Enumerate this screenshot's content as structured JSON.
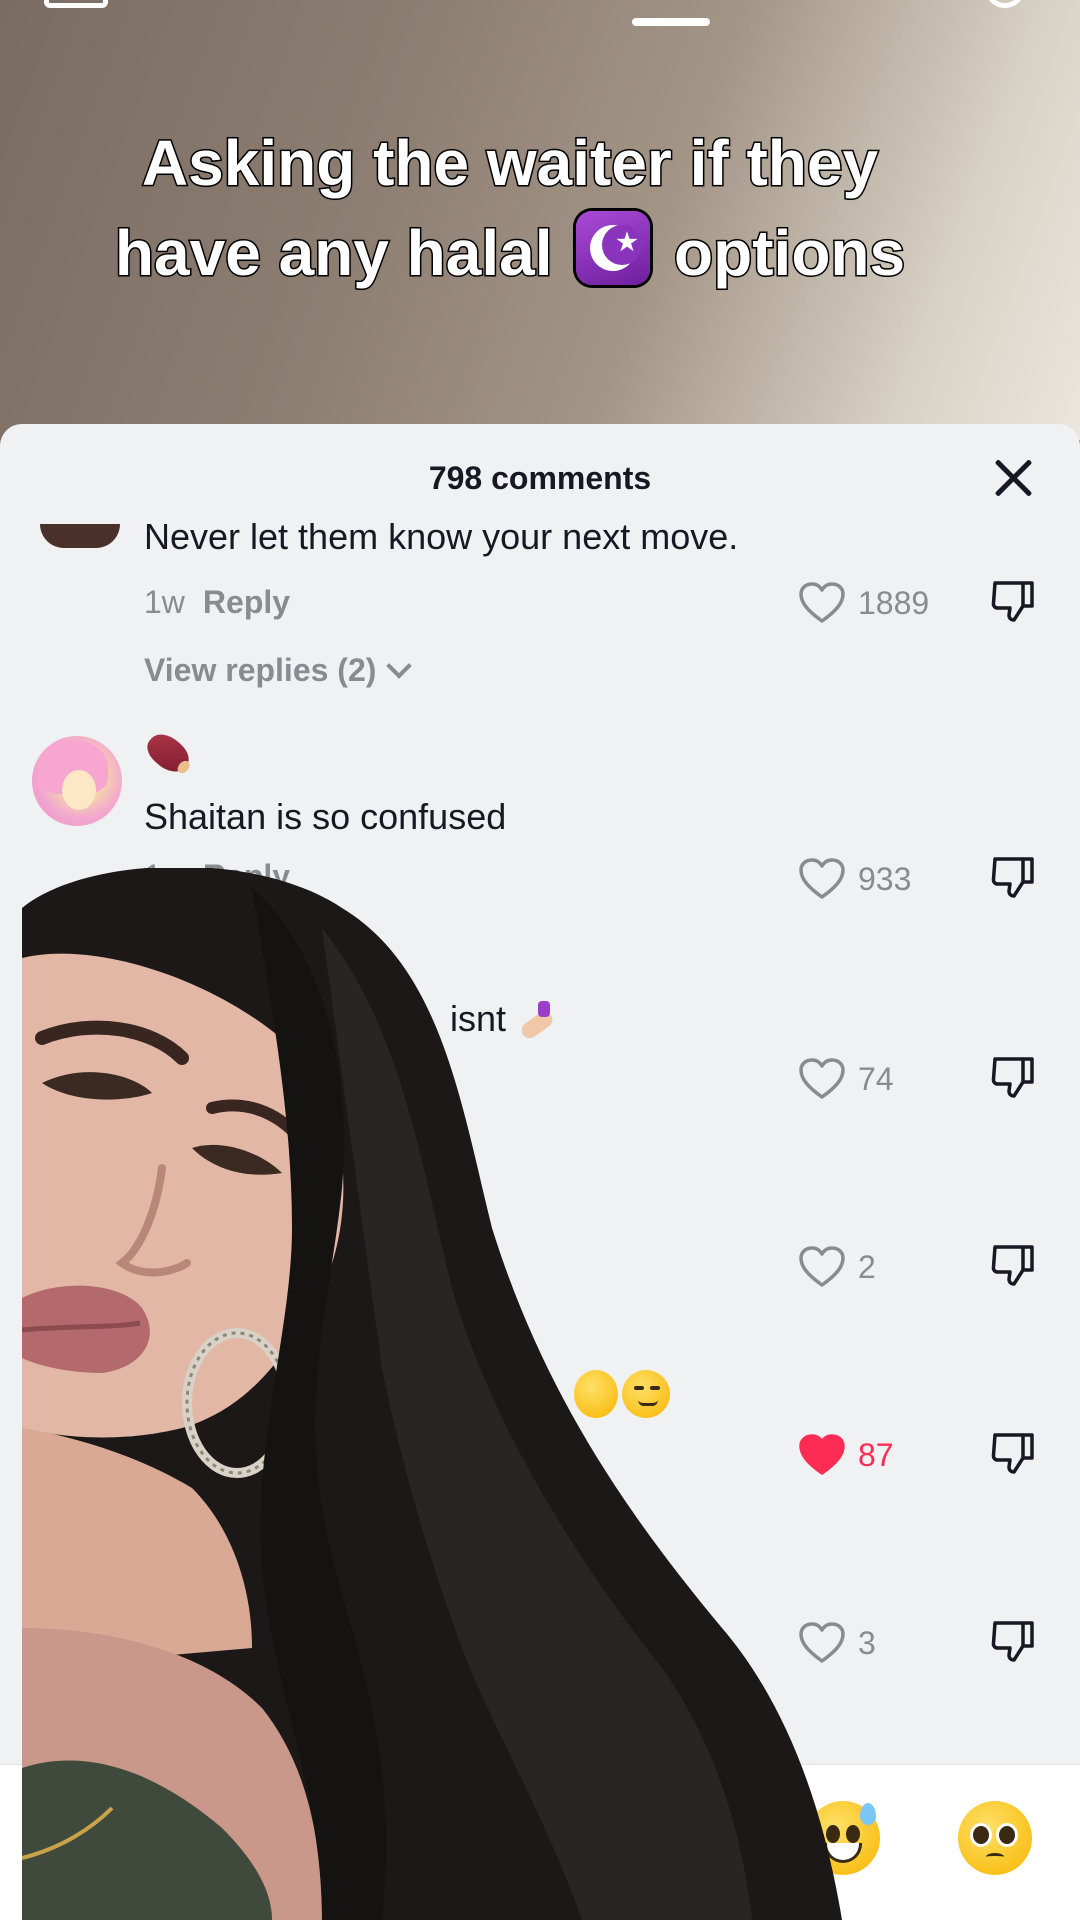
{
  "video": {
    "caption_line1": "Asking the waiter if they",
    "caption_line2_a": "have any halal",
    "caption_line2_b": "options",
    "caption_emoji": "star-and-crescent-emoji"
  },
  "comments_sheet": {
    "count_label": "798 comments",
    "close_icon": "close-icon",
    "comments": [
      {
        "text": "Never let them know your next move.",
        "time": "1w",
        "reply_label": "Reply",
        "likes": "1889",
        "liked": false,
        "view_replies": "View replies (2)"
      },
      {
        "emoji": "sweet-potato-emoji",
        "text": "Shaitan is so confused",
        "time": "1w",
        "reply_label": "Reply",
        "likes": "933",
        "liked": false
      },
      {
        "text_visible": "isnt",
        "emoji": "nail-polish-emoji",
        "likes": "74",
        "liked": false
      },
      {
        "likes": "2",
        "liked": false
      },
      {
        "emoji": "weary-smirk-emoji",
        "likes": "87",
        "liked": true
      },
      {
        "likes": "3",
        "liked": false
      }
    ]
  },
  "emoji_bar": {
    "emojis": [
      "grinning-sweat-emoji",
      "pleading-face-emoji"
    ]
  },
  "colors": {
    "liked": "#fe2c55",
    "muted_text": "#8a8b91",
    "primary_text": "#161823",
    "sheet_bg": "#f0f1f2"
  }
}
